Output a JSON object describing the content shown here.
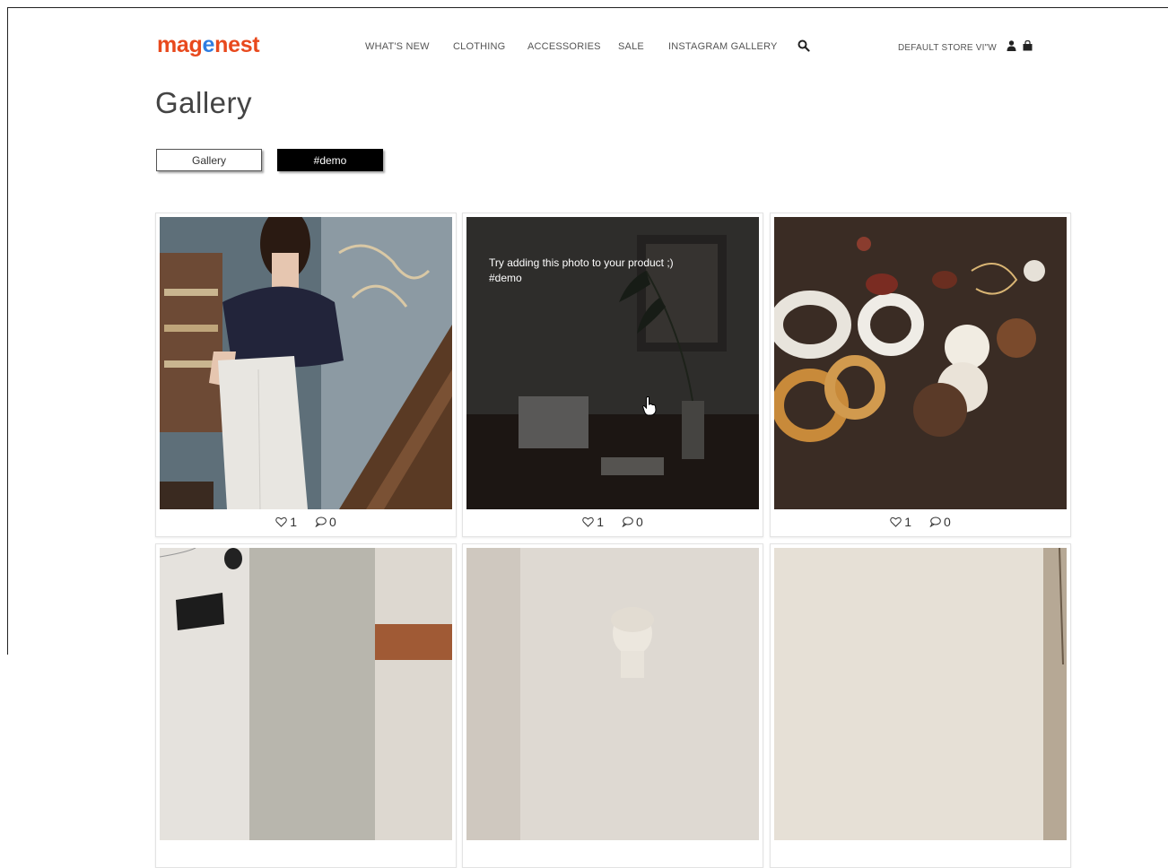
{
  "brand": {
    "logo_part1": "mag",
    "logo_mark": "e",
    "logo_part2": "nest",
    "color_orange": "#e8491d",
    "color_blue": "#2f7de1"
  },
  "nav": {
    "items": [
      "WHAT'S NEW",
      "CLOTHING",
      "ACCESSORIES",
      "SALE",
      "INSTAGRAM GALLERY"
    ],
    "search_icon": "search-icon",
    "store_view": "DEFAULT STORE VI\"W",
    "user_icon": "user-icon",
    "cart_icon": "shopping-bag-icon"
  },
  "page": {
    "title": "Gallery"
  },
  "filters": [
    {
      "label": "Gallery",
      "active": false
    },
    {
      "label": "#demo",
      "active": true
    }
  ],
  "gallery": {
    "items": [
      {
        "subject": "woman in off-shoulder blouse on stairs",
        "likes": "1",
        "comments": "0",
        "hovered": false
      },
      {
        "subject": "dark desk with laptop and flower vase",
        "likes": "1",
        "comments": "0",
        "hovered": true,
        "overlay_line1": "Try adding this photo to your product ;)",
        "overlay_line2": "#demo"
      },
      {
        "subject": "resin hoop earrings on dark table",
        "likes": "1",
        "comments": "0",
        "hovered": false
      },
      {
        "subject": "speaker on concrete wall",
        "hovered": false
      },
      {
        "subject": "white bust sculpture",
        "hovered": false
      },
      {
        "subject": "beige wall with arch",
        "hovered": false
      }
    ]
  }
}
